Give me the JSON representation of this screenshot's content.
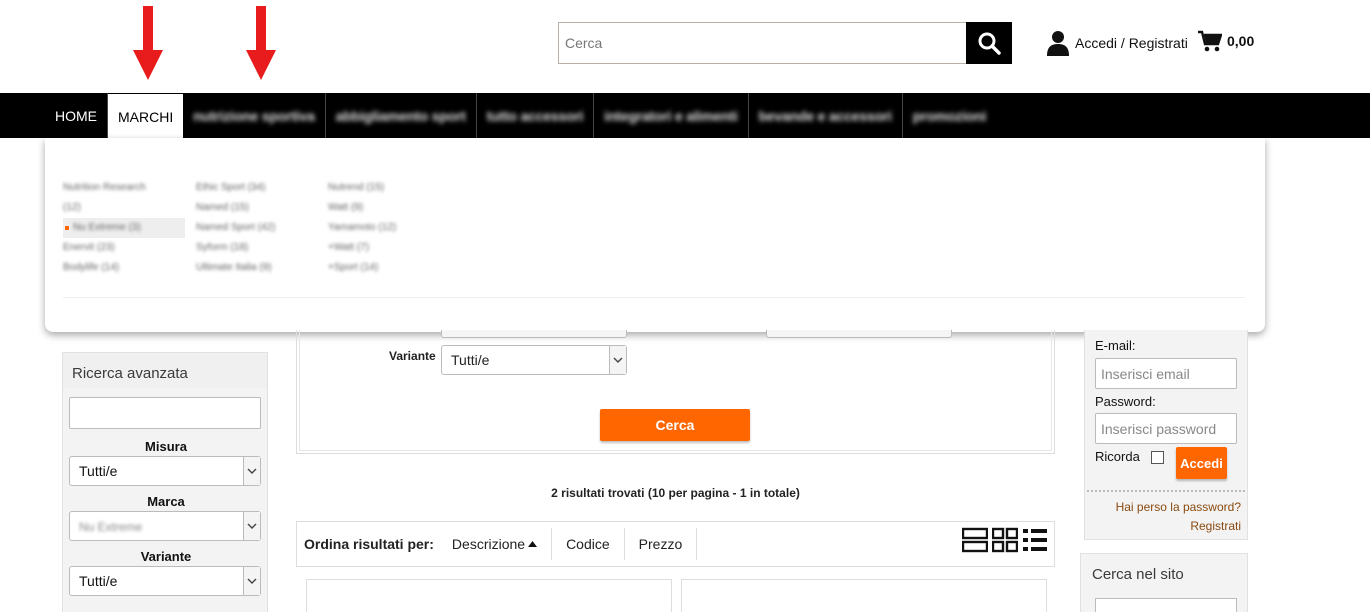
{
  "annotations": {
    "arrow_color": "#e81c1c"
  },
  "search": {
    "placeholder": "Cerca",
    "button_icon": "search-icon"
  },
  "account": {
    "label": "Accedi / Registrati",
    "icon": "user-icon"
  },
  "cart": {
    "total": "0,00",
    "icon": "cart-icon"
  },
  "nav": {
    "home": "HOME",
    "marchi": "MARCHI",
    "blurred_items": [
      "nutrizione sportiva",
      "abbigliamento sport",
      "tutto accessori",
      "integratori e alimenti",
      "bevande e accessori",
      "promozioni"
    ]
  },
  "dropdown": {
    "col1": [
      "Nutrition Research",
      "(12)",
      "Nu Extreme (3)",
      "Enervit (23)",
      "Bodylife (14)"
    ],
    "col2": [
      "Ethic Sport (34)",
      "Named (15)",
      "Named Sport (42)",
      "Syform (18)",
      "Ultimate Italia (9)"
    ],
    "col3": [
      "Nutrend (15)",
      "Watt (9)",
      "Yamamoto (12)",
      "+Watt (7)",
      "+Sport (14)"
    ],
    "selected_color": "#ff6600"
  },
  "left_panel": {
    "title": "Ricerca avanzata",
    "misura_label": "Misura",
    "misura_value": "Tutti/e",
    "marca_label": "Marca",
    "marca_value": "Nu Extreme",
    "variante_label": "Variante",
    "variante_value": "Tutti/e"
  },
  "center": {
    "variante_label": "Variante",
    "variante_value": "Tutti/e",
    "search_button": "Cerca",
    "button_color": "#ff6600"
  },
  "results": {
    "text": "2 risultati trovati (10 per pagina - 1 in totale)"
  },
  "sortbar": {
    "label": "Ordina risultati per:",
    "options": [
      "Descrizione",
      "Codice",
      "Prezzo"
    ],
    "view_icons": [
      "list-view-icon",
      "grid-view-icon",
      "detail-list-icon"
    ]
  },
  "login": {
    "email_label": "E-mail:",
    "email_placeholder": "Inserisci email",
    "password_label": "Password:",
    "password_placeholder": "Inserisci password",
    "remember_label": "Ricorda",
    "submit": "Accedi",
    "forgot": "Hai perso la password?",
    "register": "Registrati"
  },
  "site_search": {
    "title": "Cerca nel sito"
  }
}
